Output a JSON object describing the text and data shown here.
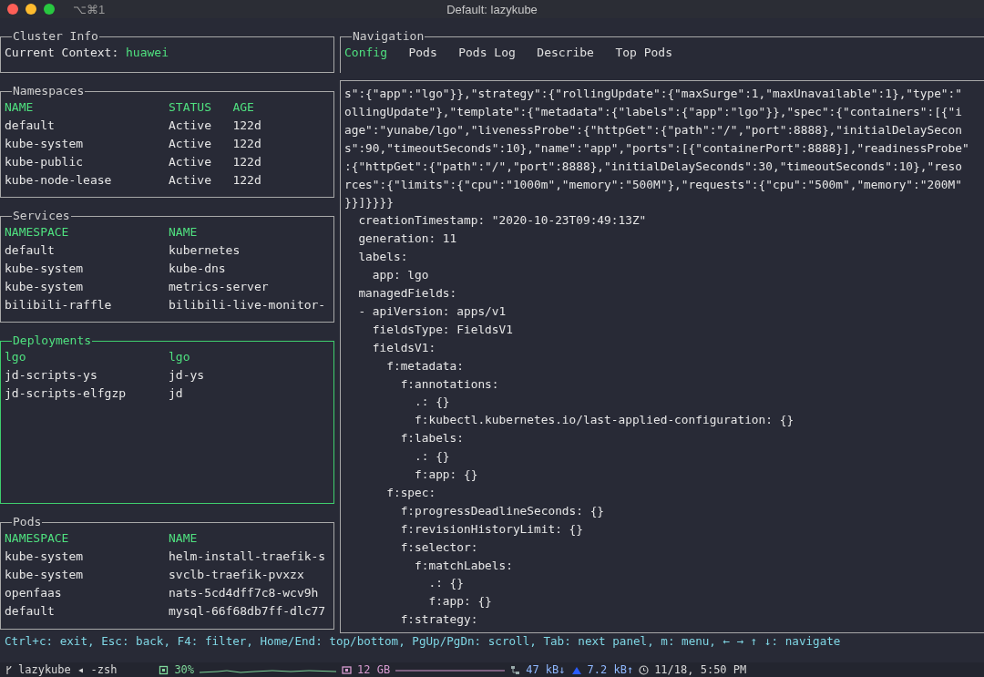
{
  "window": {
    "shortcut": "⌥⌘1",
    "title": "Default: lazykube"
  },
  "cluster_info": {
    "title": "Cluster Info",
    "label": "Current Context:",
    "context": "huawei"
  },
  "panels": [
    {
      "title": "Namespaces",
      "focused": false,
      "columns": [
        "NAME",
        "STATUS",
        "AGE"
      ],
      "rows": [
        {
          "cells": [
            "default",
            "Active",
            "122d"
          ]
        },
        {
          "cells": [
            "kube-system",
            "Active",
            "122d"
          ]
        },
        {
          "cells": [
            "kube-public",
            "Active",
            "122d"
          ]
        },
        {
          "cells": [
            "kube-node-lease",
            "Active",
            "122d"
          ]
        }
      ]
    },
    {
      "title": "Services",
      "focused": false,
      "columns": [
        "NAMESPACE",
        "NAME"
      ],
      "rows": [
        {
          "cells": [
            "default",
            "kubernetes"
          ]
        },
        {
          "cells": [
            "kube-system",
            "kube-dns"
          ]
        },
        {
          "cells": [
            "kube-system",
            "metrics-server"
          ]
        },
        {
          "cells": [
            "bilibili-raffle",
            "bilibili-live-monitor-"
          ]
        }
      ]
    },
    {
      "title": "Deployments",
      "focused": true,
      "rows": [
        {
          "cells": [
            "lgo",
            "lgo"
          ],
          "selected": true
        },
        {
          "cells": [
            "jd-scripts-ys",
            "jd-ys"
          ],
          "selected": false
        },
        {
          "cells": [
            "jd-scripts-elfgzp",
            "jd"
          ],
          "selected": false
        }
      ]
    },
    {
      "title": "Pods",
      "focused": false,
      "columns": [
        "NAMESPACE",
        "NAME"
      ],
      "rows": [
        {
          "cells": [
            "kube-system",
            "helm-install-traefik-s"
          ]
        },
        {
          "cells": [
            "kube-system",
            "svclb-traefik-pvxzx"
          ]
        },
        {
          "cells": [
            "openfaas",
            "nats-5cd4dff7c8-wcv9h"
          ]
        },
        {
          "cells": [
            "default",
            "mysql-66f68db7ff-dlc77"
          ]
        }
      ]
    }
  ],
  "navigation": {
    "title": "Navigation",
    "tabs": [
      {
        "label": "Config",
        "selected": true
      },
      {
        "label": "Pods",
        "selected": false
      },
      {
        "label": "Pods Log",
        "selected": false
      },
      {
        "label": "Describe",
        "selected": false
      },
      {
        "label": "Top Pods",
        "selected": false
      }
    ],
    "content_lines": [
      "s\":{\"app\":\"lgo\"}},\"strategy\":{\"rollingUpdate\":{\"maxSurge\":1,\"maxUnavailable\":1},\"type\":\"",
      "ollingUpdate\"},\"template\":{\"metadata\":{\"labels\":{\"app\":\"lgo\"}},\"spec\":{\"containers\":[{\"i",
      "age\":\"yunabe/lgo\",\"livenessProbe\":{\"httpGet\":{\"path\":\"/\",\"port\":8888},\"initialDelaySecon",
      "s\":90,\"timeoutSeconds\":10},\"name\":\"app\",\"ports\":[{\"containerPort\":8888}],\"readinessProbe\"",
      ":{\"httpGet\":{\"path\":\"/\",\"port\":8888},\"initialDelaySeconds\":30,\"timeoutSeconds\":10},\"reso",
      "rces\":{\"limits\":{\"cpu\":\"1000m\",\"memory\":\"500M\"},\"requests\":{\"cpu\":\"500m\",\"memory\":\"200M\"",
      "}}]}}}}",
      "  creationTimestamp: \"2020-10-23T09:49:13Z\"",
      "  generation: 11",
      "  labels:",
      "    app: lgo",
      "  managedFields:",
      "  - apiVersion: apps/v1",
      "    fieldsType: FieldsV1",
      "    fieldsV1:",
      "      f:metadata:",
      "        f:annotations:",
      "          .: {}",
      "          f:kubectl.kubernetes.io/last-applied-configuration: {}",
      "        f:labels:",
      "          .: {}",
      "          f:app: {}",
      "      f:spec:",
      "        f:progressDeadlineSeconds: {}",
      "        f:revisionHistoryLimit: {}",
      "        f:selector:",
      "          f:matchLabels:",
      "            .: {}",
      "            f:app: {}",
      "        f:strategy:"
    ]
  },
  "help_bar": "Ctrl+c: exit, Esc: back, F4: filter, Home/End: top/bottom, PgUp/PgDn: scroll, Tab: next panel, m: menu, ← → ↑ ↓: navigate",
  "status_bar": {
    "session": "lazykube ◂ -zsh",
    "cpu": "30%",
    "memory": "12 GB",
    "download": "47 kB↓",
    "upload": "7.2 kB↑",
    "clock": "11/18, 5:50 PM"
  }
}
